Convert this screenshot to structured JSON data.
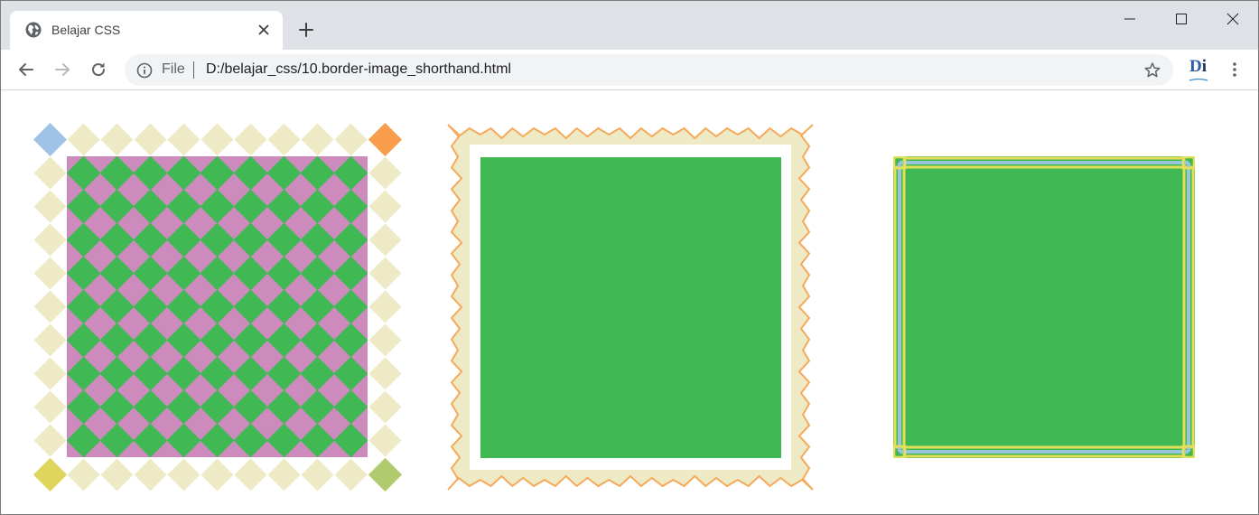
{
  "browser": {
    "tab": {
      "title": "Belajar CSS",
      "favicon": "globe-icon",
      "close_icon": "close-icon"
    },
    "new_tab_icon": "plus-icon",
    "window_controls": [
      "minimize-icon",
      "maximize-icon",
      "close-icon"
    ],
    "toolbar": {
      "back_icon": "arrow-left-icon",
      "forward_icon": "arrow-right-icon",
      "reload_icon": "reload-icon",
      "omnibox": {
        "info_icon": "info-icon",
        "scheme_label": "File",
        "url": "D:/belajar_css/10.border-image_shorthand.html",
        "bookmark_icon": "star-icon"
      },
      "extension": {
        "label_d": "D",
        "label_i": "i"
      },
      "menu_icon": "three-dots-vertical-icon"
    }
  },
  "colors": {
    "tabstrip": "#dee1e6",
    "content_green": "#40b954",
    "diamond_pink": "#cd8bbd",
    "diamond_cream": "#eeeac5",
    "corner_blue": "#9fc2e7",
    "corner_orange": "#f79d4c",
    "corner_yellow": "#dfd55c",
    "corner_green": "#b0cb6e",
    "stamp_outline": "#f5a95a",
    "frame_yellow": "#e5de57",
    "frame_blue": "#98c6d8"
  }
}
